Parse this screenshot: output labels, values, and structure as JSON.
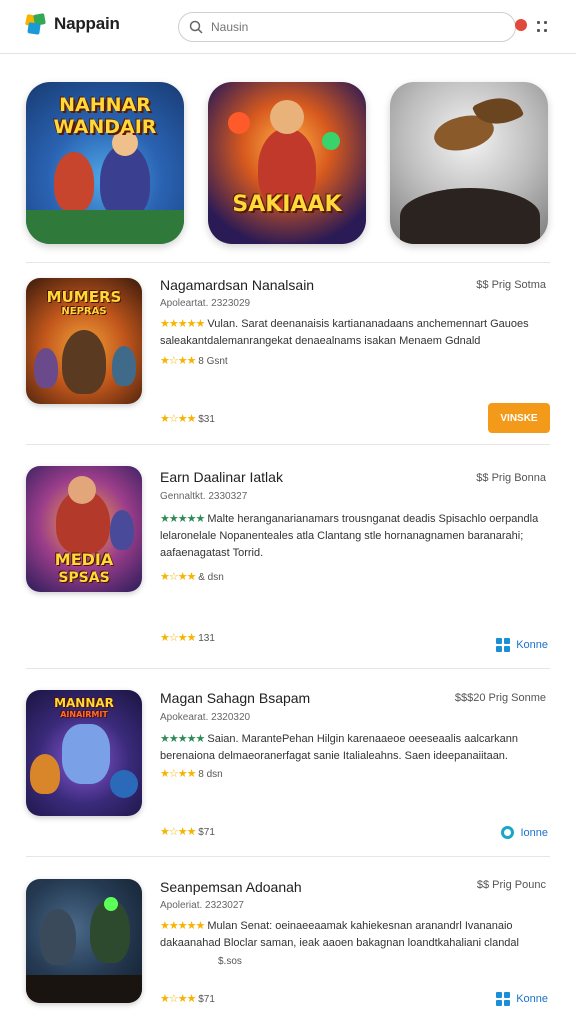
{
  "header": {
    "app_name": "Nappain",
    "search_placeholder": "Nausin",
    "colors": {
      "notification": "#e14a3b",
      "accent": "#f39a1a",
      "link": "#1a73c9"
    }
  },
  "featured": [
    {
      "title_line1": "NAHNAR",
      "title_line2": "WANDAIR"
    },
    {
      "title_line1": "SAKIAAK"
    },
    {
      "title_line1": ""
    }
  ],
  "items": [
    {
      "thumb_line1": "MUMERS",
      "thumb_line2": "NEPRAS",
      "title": "Nagamardsan Nanalsain",
      "meta": "Apoleartat. 2323029",
      "price": "$$ Prig Sotma",
      "stars1": "★★★★★",
      "desc": "Vulan. Sarat deenanaisis  kartiananadaans anchemennart Gauoes saleakantdalemanrangekat denaealnams isakan Menaem Gdnald",
      "stars2": "★☆★★",
      "stars2_label": "8 Gsnt",
      "stars3": "★☆★★",
      "stars3_label": "$31",
      "action": "VINSKE",
      "action_type": "button"
    },
    {
      "thumb_line1": "MEDIA",
      "thumb_line2": "SPSAS",
      "title": "Earn Daalinar Iatlak",
      "meta": "Gennaltkt. 2330327",
      "price": "$$ Prig Bonna",
      "stars1": "★★★★★",
      "desc": "Malte heranganarianamars trousnganat deadis Spisachlo oerpandla lelaronelale Nopanenteales atla Clantang stle hornanagnamen baranarahi; aafaenagatast Torrid.",
      "stars2": "★☆★★",
      "stars2_label": "& dsn",
      "stars3": "★☆★★",
      "stars3_label": "131",
      "action": "Konne",
      "action_type": "grid"
    },
    {
      "thumb_line1": "MANNAR",
      "thumb_line2": "AINAIRMIT",
      "title": "Magan Sahagn Bsapam",
      "meta": "Apokearat. 2320320",
      "price": "$$$20 Prig Sonme",
      "stars1": "★★★★★",
      "desc": "Saian. MarantePehan Hilgin karenaaeoe oeeseaalis aalcarkann berenaiona delmaeoranerfagat sanie Italialeahns. Saen ideepanaiitaan.",
      "stars2": "★☆★★",
      "stars2_label": "8 dsn",
      "stars3": "★☆★★",
      "stars3_label": "$71",
      "action": "Ionne",
      "action_type": "ring"
    },
    {
      "thumb_line1": "",
      "thumb_line2": "",
      "title": "Seanpemsan Adoanah",
      "meta": "Apoleriat. 2323027",
      "price": "$$ Prig Pounc",
      "stars1": "★★★★★",
      "desc": "Mulan Senat: oeinaeeaamak kahiekesnan aranandrl Ivananaio dakaanahad Bloclar saman, ieak aaoen bakagnan loandtkahaliani clandal",
      "stars2": "",
      "stars2_label": "$.sos",
      "stars3": "★☆★★",
      "stars3_label": "$71",
      "action": "Konne",
      "action_type": "grid"
    }
  ]
}
